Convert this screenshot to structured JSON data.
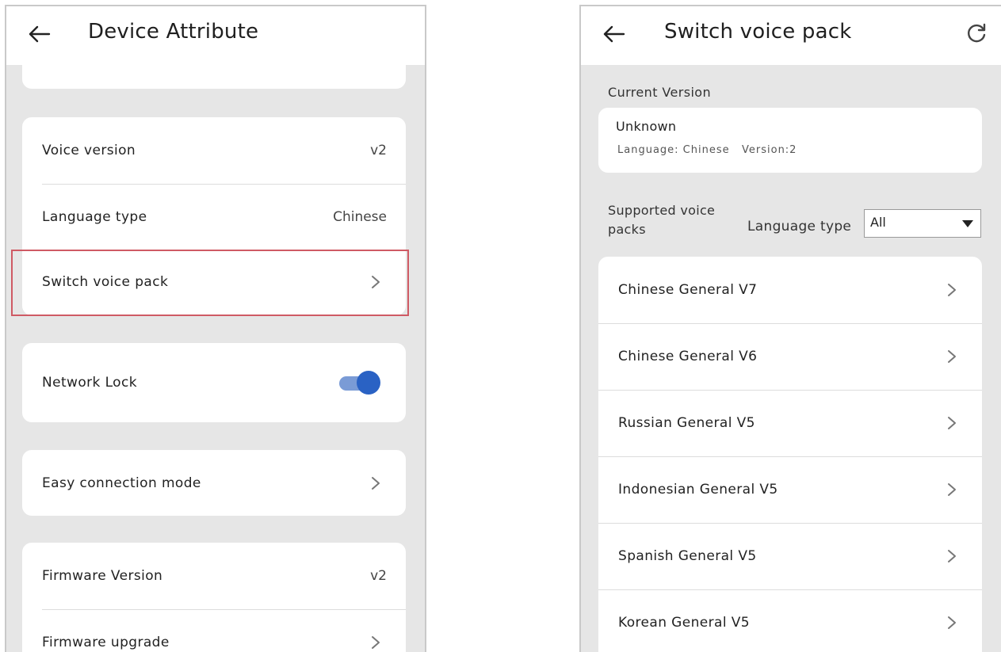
{
  "left": {
    "title": "Device Attribute",
    "voice_version": {
      "label": "Voice version",
      "value": "v2"
    },
    "language_type": {
      "label": "Language type",
      "value": "Chinese"
    },
    "switch_voice_pack": {
      "label": "Switch voice pack"
    },
    "network_lock": {
      "label": "Network Lock",
      "enabled": true
    },
    "easy_connection": {
      "label": "Easy connection mode"
    },
    "firmware_version": {
      "label": "Firmware Version",
      "value": "v2"
    },
    "firmware_upgrade": {
      "label": "Firmware upgrade"
    }
  },
  "right": {
    "title": "Switch voice pack",
    "current_version": {
      "heading": "Current Version",
      "name": "Unknown",
      "meta": "Language: Chinese   Version:2"
    },
    "supported_label": "Supported voice packs",
    "language_filter": {
      "label": "Language type",
      "selected": "All"
    },
    "packs": [
      {
        "label": "Chinese General V7"
      },
      {
        "label": "Chinese General V6"
      },
      {
        "label": "Russian General V5"
      },
      {
        "label": "Indonesian General V5"
      },
      {
        "label": "Spanish General V5"
      },
      {
        "label": "Korean General V5"
      }
    ]
  },
  "colors": {
    "highlight": "#cf5a64",
    "toggle_on": "#2a62c4",
    "background": "#e6e6e6"
  }
}
